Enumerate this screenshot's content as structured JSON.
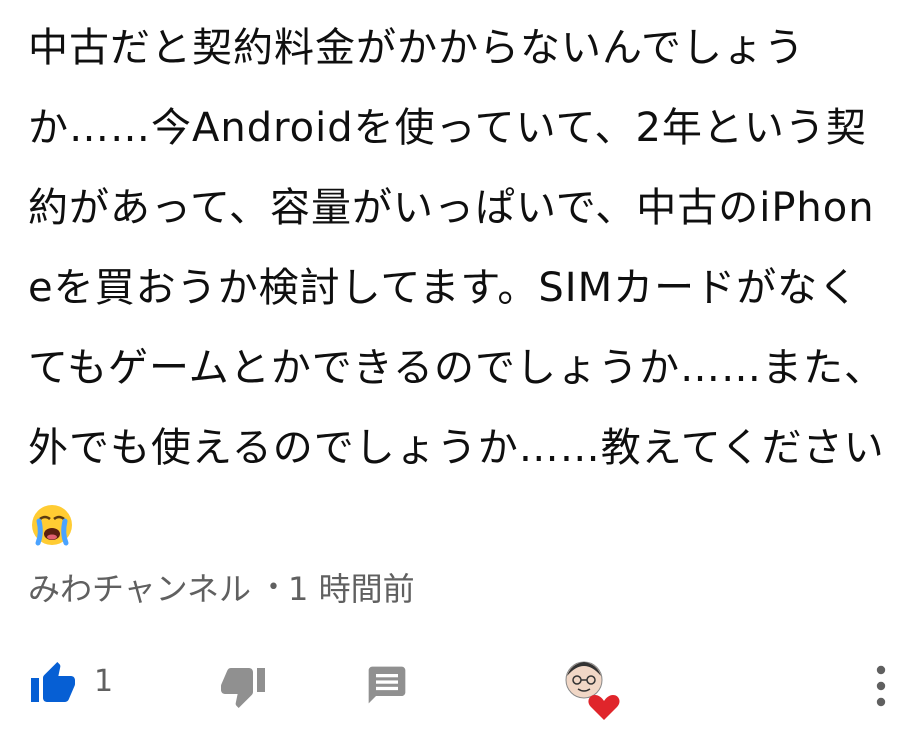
{
  "comment": {
    "text": "中古だと契約料金がかからないんでしょうか……今Androidを使っていて、2年という契約があって、容量がいっぱいで、中古のiPhoneを買おうか検討してます。SIMカードがなくてもゲームとかできるのでしょうか……また、外でも使えるのでしょうか……教えてください",
    "emoji": "loudly-crying-face",
    "author": "みわチャンネル",
    "separator": "•",
    "time": "1 時間前"
  },
  "actions": {
    "like_count": "1",
    "like_icon": "thumbs-up-icon",
    "dislike_icon": "thumbs-down-icon",
    "reply_icon": "reply-comment-icon",
    "creator_heart_icon": "creator-heart-icon",
    "more_icon": "more-vert-icon"
  },
  "colors": {
    "liked_blue": "#065fd4",
    "icon_gray": "#909090",
    "heart_red": "#e0252b",
    "meta_gray": "#606060"
  }
}
